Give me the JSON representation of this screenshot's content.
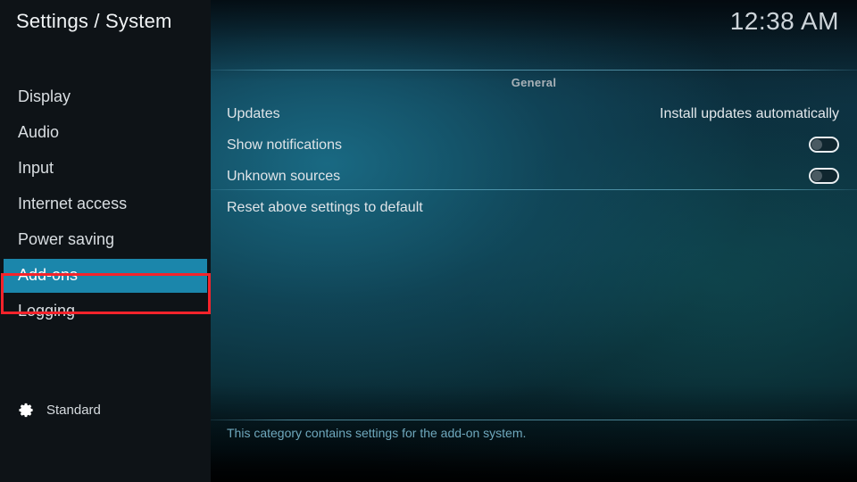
{
  "window": {
    "title": "Settings / System",
    "clock": "12:38 AM"
  },
  "sidebar": {
    "items": [
      {
        "label": "Display",
        "selected": false
      },
      {
        "label": "Audio",
        "selected": false
      },
      {
        "label": "Input",
        "selected": false
      },
      {
        "label": "Internet access",
        "selected": false
      },
      {
        "label": "Power saving",
        "selected": false
      },
      {
        "label": "Add-ons",
        "selected": true
      },
      {
        "label": "Logging",
        "selected": false
      }
    ],
    "profile": {
      "icon": "gear-icon",
      "label": "Standard"
    },
    "highlight_color": "#1b86ab",
    "annotation_color": "#f5232b"
  },
  "main": {
    "group_header": "General",
    "rows": [
      {
        "label": "Updates",
        "type": "value",
        "value": "Install updates automatically"
      },
      {
        "label": "Show notifications",
        "type": "toggle",
        "value": "off"
      },
      {
        "label": "Unknown sources",
        "type": "toggle",
        "value": "off"
      }
    ],
    "reset_label": "Reset above settings to default",
    "footer_description": "This category contains settings for the add-on system."
  }
}
